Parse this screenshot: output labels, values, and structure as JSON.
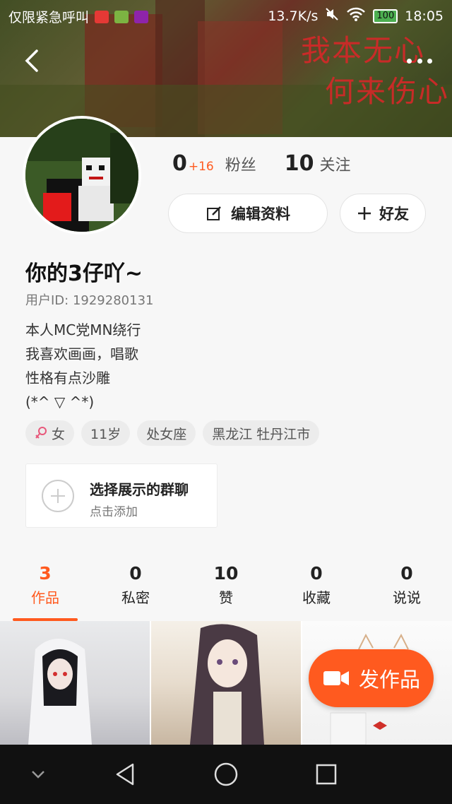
{
  "status_bar": {
    "carrier_text": "仅限紧急呼叫",
    "net_speed": "13.7K/s",
    "battery": "100",
    "time": "18:05"
  },
  "cover": {
    "line1": "我本无心",
    "line2": "何来伤心"
  },
  "profile": {
    "fans_count": "0",
    "fans_delta": "+16",
    "fans_label": "粉丝",
    "following_count": "10",
    "following_label": "关注",
    "edit_label": "编辑资料",
    "friend_label": "好友",
    "name": "你的3仔吖~",
    "user_id": "用户ID: 1929280131",
    "bio": [
      "本人MC党MN绕行",
      "我喜欢画画，唱歌",
      "性格有点沙雕",
      "(*^ ▽ ^*)"
    ],
    "tags": [
      "女",
      "11岁",
      "处女座",
      "黑龙江 牡丹江市"
    ]
  },
  "group_card": {
    "title": "选择展示的群聊",
    "subtitle": "点击添加"
  },
  "tabs": [
    {
      "count": "3",
      "label": "作品",
      "active": true
    },
    {
      "count": "0",
      "label": "私密",
      "active": false
    },
    {
      "count": "10",
      "label": "赞",
      "active": false
    },
    {
      "count": "0",
      "label": "收藏",
      "active": false
    },
    {
      "count": "0",
      "label": "说说",
      "active": false
    }
  ],
  "post_button": {
    "label": "发作品"
  },
  "colors": {
    "accent": "#ff5a1f",
    "background": "#f7f7f7"
  },
  "icons": [
    "back-icon",
    "more-icon",
    "edit-icon",
    "plus-icon",
    "female-icon",
    "camera-icon",
    "nav-back-icon",
    "nav-home-icon",
    "nav-recent-icon"
  ]
}
